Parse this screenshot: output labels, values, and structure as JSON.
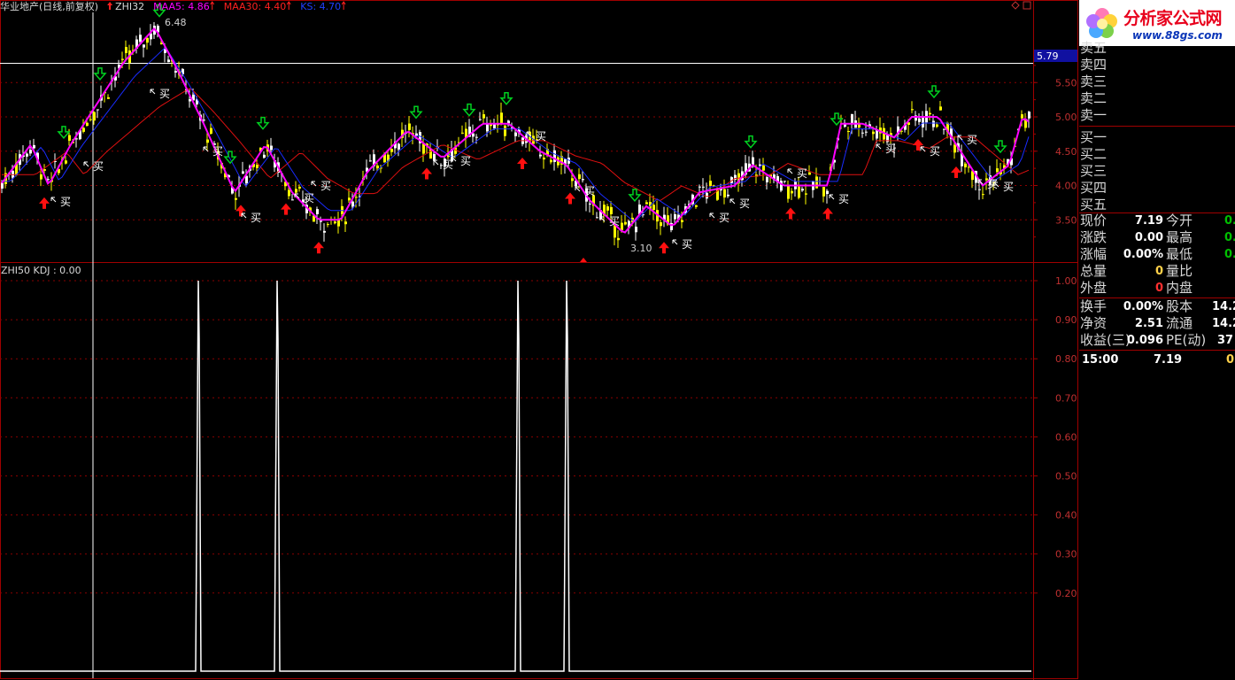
{
  "main_panel": {
    "stock_name": "华业地产",
    "period": "(日线,前复权)",
    "indicator_name": "ZHI32",
    "indicator_arrow_color": "#ff2020",
    "legend": [
      {
        "label": "MAA5: 4.86",
        "color": "#ff00ff"
      },
      {
        "label": "MAA30: 4.40",
        "color": "#ff2020"
      },
      {
        "label": "KS: 4.70",
        "color": "#2040ff"
      }
    ],
    "price_axis": [
      {
        "label": "5.50",
        "value": 5.5
      },
      {
        "label": "5.00",
        "value": 5.0
      },
      {
        "label": "4.50",
        "value": 4.5
      },
      {
        "label": "4.00",
        "value": 4.0
      },
      {
        "label": "3.50",
        "value": 3.5
      }
    ],
    "current_price_tag": "5.79",
    "high_annotation": "6.48",
    "low_annotation": "3.10",
    "buy_label": "买",
    "buy_label_count": 32,
    "window_icons": [
      "diamond-icon",
      "restore-icon"
    ]
  },
  "sub_panel": {
    "title": "ZHI50 KDJ : 0.00",
    "axis": [
      {
        "label": "1.00",
        "value": 1.0
      },
      {
        "label": "0.90",
        "value": 0.9
      },
      {
        "label": "0.80",
        "value": 0.8
      },
      {
        "label": "0.70",
        "value": 0.7
      },
      {
        "label": "0.60",
        "value": 0.6
      },
      {
        "label": "0.50",
        "value": 0.5
      },
      {
        "label": "0.40",
        "value": 0.4
      },
      {
        "label": "0.30",
        "value": 0.3
      },
      {
        "label": "0.20",
        "value": 0.2
      }
    ]
  },
  "sidebar": {
    "logo_title": "分析家公式网",
    "logo_url": "www.88gs.com",
    "order_book": [
      "卖五",
      "卖四",
      "卖三",
      "卖二",
      "卖一",
      "买一",
      "买二",
      "买三",
      "买四",
      "买五"
    ],
    "quote": {
      "price_label": "现价",
      "price": "7.19",
      "open_label": "今开",
      "open": "0.",
      "change_label": "涨跌",
      "change": "0.00",
      "high_label": "最高",
      "high": "0.",
      "pct_label": "涨幅",
      "pct": "0.00%",
      "low_label": "最低",
      "low": "0.",
      "volume_label": "总量",
      "volume": "0",
      "vol_ratio_label": "量比",
      "vol_ratio": "",
      "outer_label": "外盘",
      "outer": "0",
      "inner_label": "内盘",
      "inner": ""
    },
    "finance": {
      "turnover_label": "换手",
      "turnover": "0.00%",
      "shares_label": "股本",
      "shares": "14.2",
      "nav_label": "净资",
      "nav": "2.51",
      "float_label": "流通",
      "float": "14.2",
      "eps_label": "收益(三)",
      "eps": "0.096",
      "pe_label": "PE(动)",
      "pe": "37"
    },
    "tick": {
      "time": "15:00",
      "price": "7.19",
      "volume": "0"
    }
  },
  "colors": {
    "border_red": "#a00000",
    "grid_red": "#8a0000",
    "ma5": "#ff00ff",
    "ma30": "#e01010",
    "ks": "#1a2cff",
    "bull_candle": "#ffff00",
    "bear_candle": "#ffffff",
    "up_arrow": "#ff1010",
    "down_arrow": "#00d020",
    "axis_text": "#c03030"
  }
}
